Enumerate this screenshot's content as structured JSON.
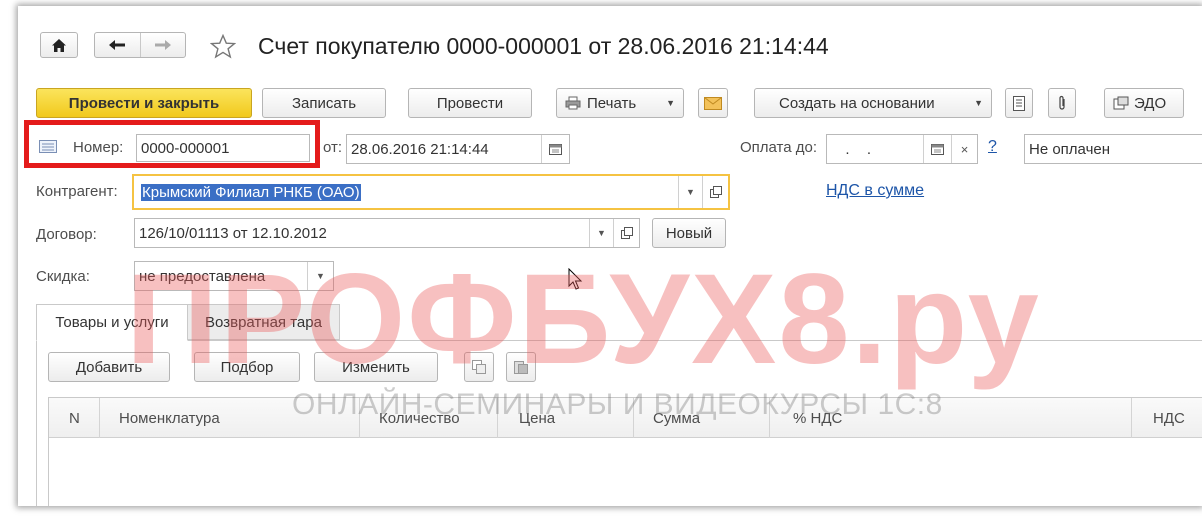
{
  "window": {
    "title": "Счет покупателю 0000-000001 от 28.06.2016 21:14:44",
    "favorite_icon": "star-icon",
    "home_icon": "home-icon",
    "back_icon": "arrow-left-icon",
    "forward_icon": "arrow-right-icon"
  },
  "toolbar": {
    "post_close_label": "Провести и закрыть",
    "save_label": "Записать",
    "post_label": "Провести",
    "print_label": "Печать",
    "create_based_label": "Создать на основании",
    "edo_label": "ЭДО"
  },
  "header": {
    "number_label": "Номер:",
    "number_value": "0000-000001",
    "date_label": "от:",
    "date_value": "28.06.2016 21:14:44",
    "pay_until_label": "Оплата до:",
    "pay_until_value": "  .  .",
    "help_label": "?",
    "payment_status": "Не оплачен",
    "counterparty_label": "Контрагент:",
    "counterparty_value": "Крымский Филиал РНКБ (ОАО)",
    "vat_link": "НДС в сумме",
    "contract_label": "Договор:",
    "contract_value": "126/10/01113 от 12.10.2012",
    "new_label": "Новый",
    "discount_label": "Скидка:",
    "discount_value": "не предоставлена"
  },
  "tabs": [
    {
      "label": "Товары и услуги",
      "active": true
    },
    {
      "label": "Возвратная тара",
      "active": false
    }
  ],
  "table_toolbar": {
    "add_label": "Добавить",
    "pick_label": "Подбор",
    "change_label": "Изменить"
  },
  "table": {
    "columns": [
      "N",
      "Номенклатура",
      "Количество",
      "Цена",
      "Сумма",
      "% НДС",
      "НДС"
    ]
  },
  "watermark": {
    "logo": "ПРОФБУХ8.ру",
    "subtitle": "ОНЛАЙН-СЕМИНАРЫ И ВИДЕОКУРСЫ 1С:8"
  },
  "colors": {
    "primary_button": "#f7d633",
    "highlight_box": "#e41b1b",
    "focus_border": "#f5c342",
    "link": "#1d55a8",
    "selection": "#3b6fc5"
  }
}
